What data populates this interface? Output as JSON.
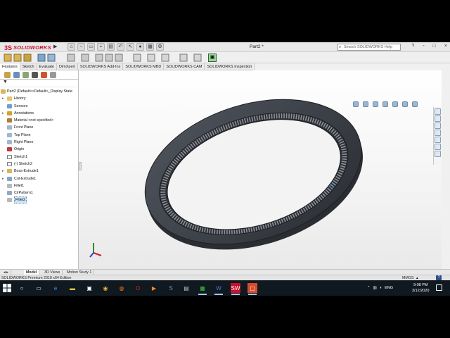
{
  "app": {
    "logo_mark": "3S",
    "logo_text": "SOLIDWORKS",
    "title": "Part2 *",
    "search_placeholder": "Search SOLIDWORKS Help",
    "window_controls": [
      "?",
      "-",
      "□",
      "×"
    ]
  },
  "command_tabs": [
    "Features",
    "Sketch",
    "Evaluate",
    "DimXpert",
    "SOLIDWORKS Add-Ins",
    "SOLIDWORKS MBD",
    "SOLIDWORKS CAM",
    "SOLIDWORKS Inspection"
  ],
  "active_command_tab": "Features",
  "feature_tree": {
    "root": "Part2  (Default<<Default>_Display State",
    "items": [
      {
        "label": "History",
        "icon": "history-folder-icon"
      },
      {
        "label": "Sensors",
        "icon": "sensors-icon"
      },
      {
        "label": "Annotations",
        "icon": "annotations-icon"
      },
      {
        "label": "Material <not specified>",
        "icon": "material-icon"
      },
      {
        "label": "Front Plane",
        "icon": "plane-icon"
      },
      {
        "label": "Top Plane",
        "icon": "plane-icon"
      },
      {
        "label": "Right Plane",
        "icon": "plane-icon"
      },
      {
        "label": "Origin",
        "icon": "origin-icon"
      },
      {
        "label": "Sketch1",
        "icon": "sketch-icon"
      },
      {
        "label": "(-) Sketch2",
        "icon": "sketch-icon"
      },
      {
        "label": "Boss-Extrude1",
        "icon": "extrude-icon"
      },
      {
        "label": "Cut-Extrude1",
        "icon": "cut-extrude-icon"
      },
      {
        "label": "Fillet1",
        "icon": "fillet-icon"
      },
      {
        "label": "CirPattern1",
        "icon": "circular-pattern-icon"
      },
      {
        "label": "Fillet2",
        "icon": "fillet-icon"
      }
    ],
    "selected": "Fillet2"
  },
  "bottom_tabs": [
    "Model",
    "3D Views",
    "Motion Study 1"
  ],
  "active_bottom_tab": "Model",
  "status": {
    "text": "SOLIDWORKS Premium 2018 x64 Edition",
    "units": "MMGS",
    "help": "?"
  },
  "taskbar": {
    "language": "ENG",
    "time": "9:08 PM",
    "date": "3/12/2020",
    "apps": [
      "search-icon",
      "task-view-icon",
      "edge-icon",
      "file-explorer-icon",
      "store-icon",
      "chrome-icon",
      "firefox-icon",
      "opera-icon",
      "media-player-icon",
      "skype-icon",
      "photos-icon",
      "camtasia-icon",
      "word-icon",
      "solidworks-icon",
      "recorder-icon"
    ]
  },
  "colors": {
    "accent": "#2a6fb5",
    "solidworks_red": "#c8102e",
    "part_color": "#3b3f46",
    "selection": "#cfe3f7"
  }
}
